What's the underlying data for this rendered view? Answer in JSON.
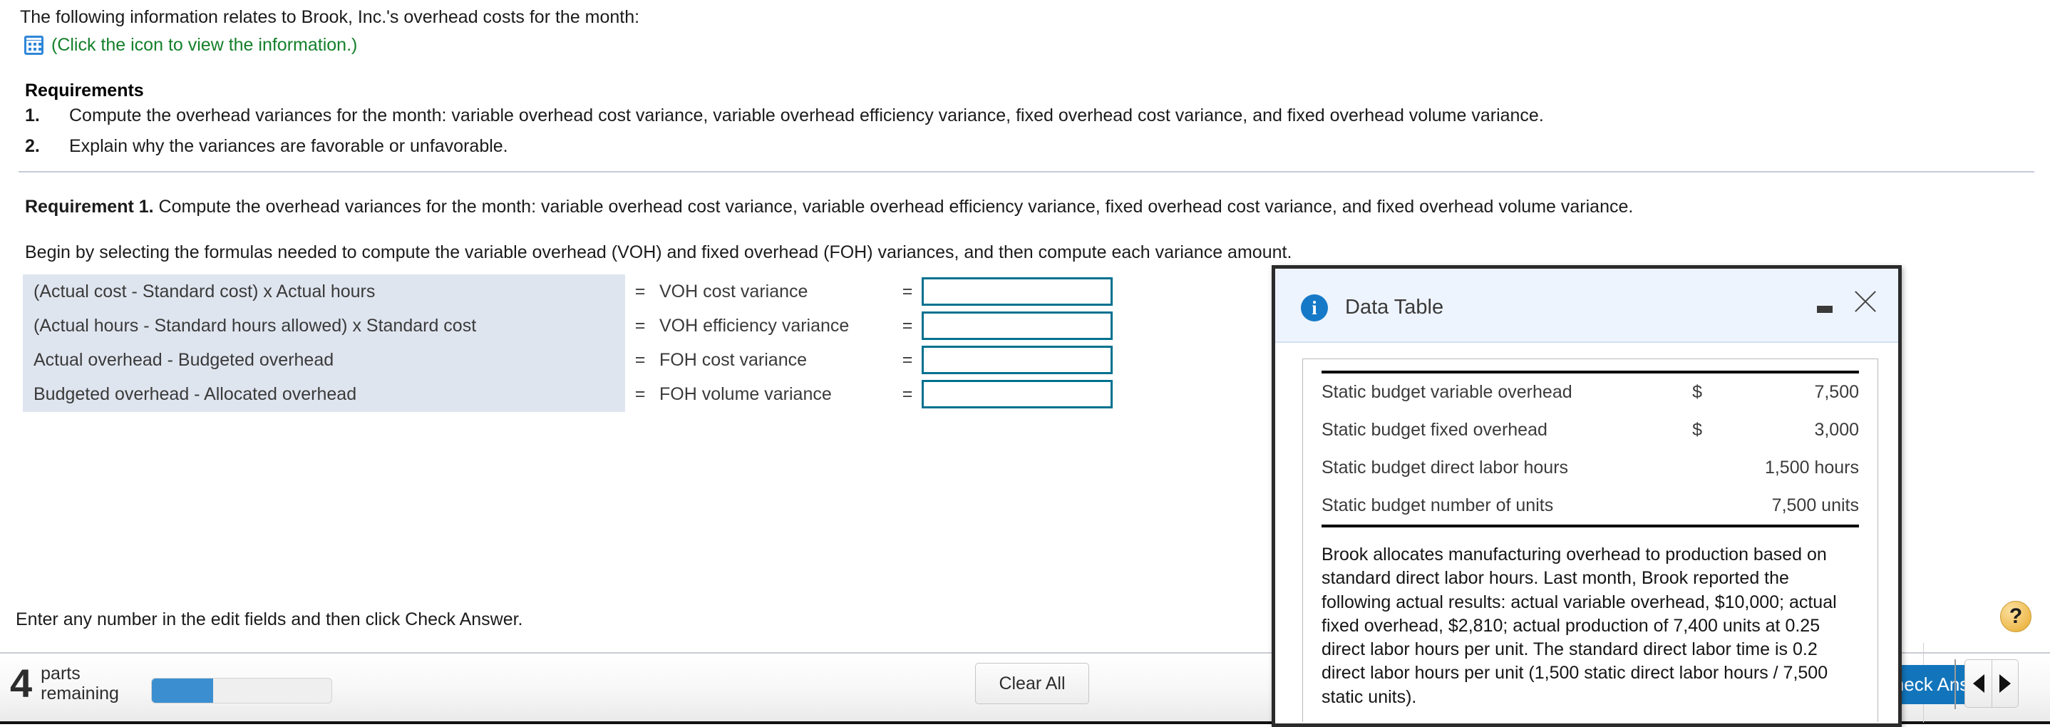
{
  "intro": {
    "statement": "The following information relates to Brook, Inc.'s overhead costs for the month:",
    "icon_name": "data-table-icon",
    "icon_link_text": "(Click the icon to view the information.)"
  },
  "requirements": {
    "heading": "Requirements",
    "items": [
      {
        "num": "1.",
        "text": "Compute the overhead variances for the month: variable overhead cost variance, variable overhead efficiency variance, fixed overhead cost variance, and fixed overhead volume variance."
      },
      {
        "num": "2.",
        "text": "Explain why the variances are favorable or unfavorable."
      }
    ]
  },
  "requirement1": {
    "label": "Requirement 1.",
    "text": " Compute the overhead variances for the month: variable overhead cost variance, variable overhead efficiency variance, fixed overhead cost variance, and fixed overhead volume variance.",
    "instruction": "Begin by selecting the formulas needed to compute the variable overhead (VOH) and fixed overhead (FOH) variances, and then compute each variance amount."
  },
  "formula_rows": [
    {
      "formula": "(Actual cost - Standard cost) x Actual hours",
      "eq1": "=",
      "label": "VOH cost variance",
      "eq2": "=",
      "value": ""
    },
    {
      "formula": "(Actual hours - Standard hours allowed) x Standard cost",
      "eq1": "=",
      "label": "VOH efficiency variance",
      "eq2": "=",
      "value": ""
    },
    {
      "formula": "Actual overhead - Budgeted overhead",
      "eq1": "=",
      "label": "FOH cost variance",
      "eq2": "=",
      "value": ""
    },
    {
      "formula": "Budgeted overhead - Allocated overhead",
      "eq1": "=",
      "label": "FOH volume variance",
      "eq2": "=",
      "value": ""
    }
  ],
  "bottom": {
    "note": "Enter any number in the edit fields and then click Check Answer."
  },
  "footer": {
    "parts_remaining_count": "4",
    "parts_word": "parts",
    "remaining_word": "remaining",
    "progress_percent": "34",
    "clear_all_label": "Clear All",
    "check_answer_label": "Check Answer",
    "prev_icon": "triangle-left-icon",
    "next_icon": "triangle-right-icon",
    "help_label": "?"
  },
  "dialog": {
    "title": "Data Table",
    "info_icon": "info-icon",
    "minimize_icon": "minimize-icon",
    "close_icon": "close-icon",
    "rows": [
      {
        "label": "Static budget variable overhead",
        "currency": "$",
        "value": "7,500"
      },
      {
        "label": "Static budget fixed overhead",
        "currency": "$",
        "value": "3,000"
      },
      {
        "label": "Static budget direct labor hours",
        "currency": "",
        "value": "1,500 hours"
      },
      {
        "label": "Static budget number of units",
        "currency": "",
        "value": "7,500 units"
      }
    ],
    "note": "Brook allocates manufacturing overhead to production based on standard direct labor hours. Last month, Brook reported the following actual results: actual variable overhead, $10,000; actual fixed overhead, $2,810; actual production of 7,400 units at 0.25 direct labor hours per unit. The standard direct labor time is 0.2 direct labor hours per unit (1,500 static direct labor hours / 7,500 static units)."
  },
  "colors": {
    "link_green": "#15802b",
    "input_border": "#00718f",
    "formula_shade": "#dfe5ef",
    "accent_blue": "#1275bc",
    "help_yellow": "#eeb94c"
  }
}
